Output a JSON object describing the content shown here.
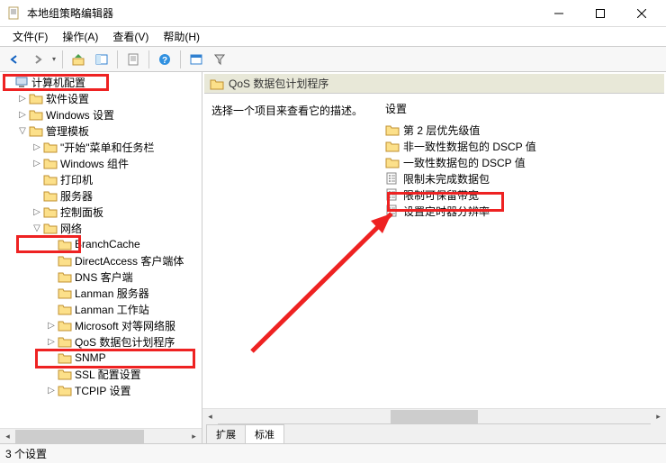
{
  "window": {
    "title": "本地组策略编辑器",
    "min_tip": "最小化",
    "max_tip": "最大化",
    "close_tip": "关闭"
  },
  "menubar": {
    "file": "文件(F)",
    "action": "操作(A)",
    "view": "查看(V)",
    "help": "帮助(H)"
  },
  "tree": {
    "root": "计算机配置",
    "software_settings": "软件设置",
    "windows_settings": "Windows 设置",
    "admin_templates": "管理模板",
    "start_taskbar": "\"开始\"菜单和任务栏",
    "windows_components": "Windows 组件",
    "printers": "打印机",
    "servers": "服务器",
    "control_panel": "控制面板",
    "network": "网络",
    "branchcache": "BranchCache",
    "directaccess": "DirectAccess 客户端体",
    "dns_client": "DNS 客户端",
    "lanman_server": "Lanman 服务器",
    "lanman_workstation": "Lanman 工作站",
    "microsoft_peer": "Microsoft 对等网络服",
    "qos": "QoS 数据包计划程序",
    "snmp": "SNMP",
    "ssl_config": "SSL 配置设置",
    "tcpip": "TCPIP 设置"
  },
  "content": {
    "header": "QoS 数据包计划程序",
    "desc_prompt": "选择一个项目来查看它的描述。",
    "setting_header": "设置",
    "items": {
      "layer2_priority": "第 2 层优先级值",
      "nonconformant_dscp": "非一致性数据包的 DSCP 值",
      "conformant_dscp": "一致性数据包的 DSCP 值",
      "limit_outstanding": "限制未完成数据包",
      "limit_reservable_bandwidth": "限制可保留带宽",
      "set_timer_resolution": "设置定时器分辨率"
    },
    "tabs": {
      "extended": "扩展",
      "standard": "标准"
    }
  },
  "statusbar": {
    "text": "3 个设置"
  }
}
